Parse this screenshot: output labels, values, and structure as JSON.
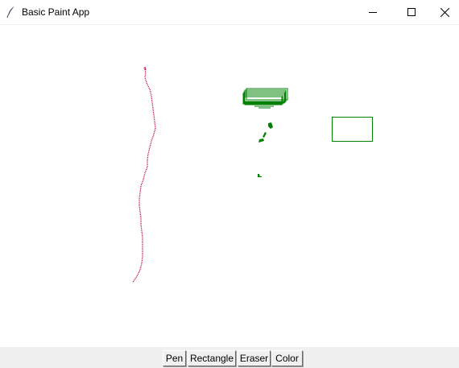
{
  "window": {
    "title": "Basic Paint App"
  },
  "titlebar_icons": {
    "app": "feather-icon",
    "minimize": "minimize-icon",
    "maximize": "maximize-icon",
    "close": "close-icon"
  },
  "toolbar": {
    "pen_label": "Pen",
    "rectangle_label": "Rectangle",
    "eraser_label": "Eraser",
    "color_label": "Color"
  },
  "colors": {
    "pen_stroke": "#c0103c",
    "shape_stroke": "#008000",
    "toolbar_bg": "#f0f0f0"
  }
}
